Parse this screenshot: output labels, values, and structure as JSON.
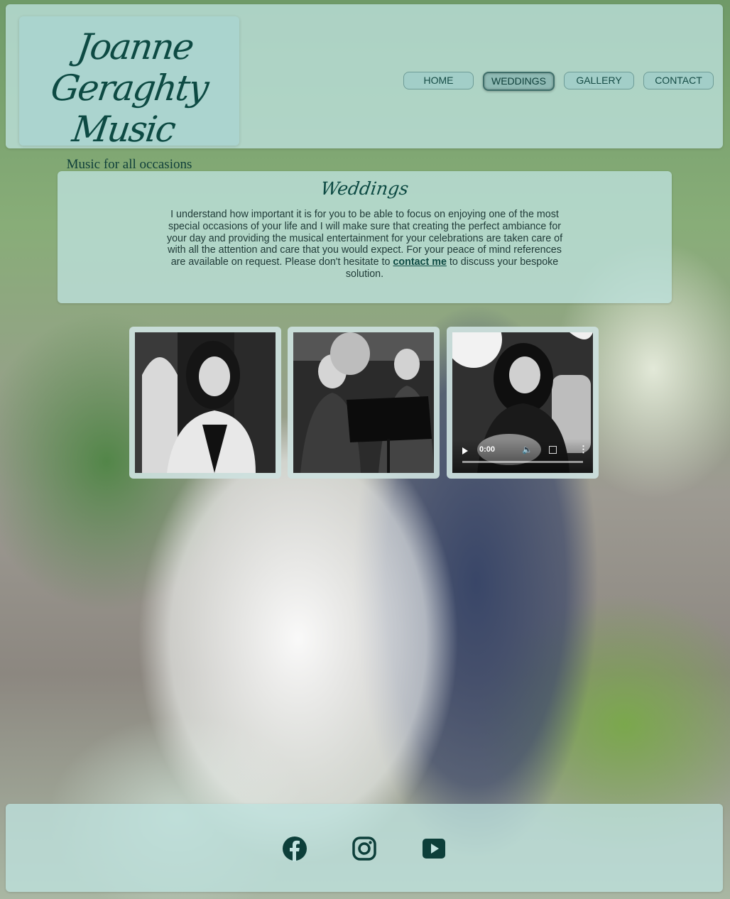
{
  "brand": {
    "name_line1": "Joanne Geraghty",
    "name_line2": "Music",
    "tagline": "Music for all occasions"
  },
  "nav": {
    "items": [
      {
        "label": "HOME"
      },
      {
        "label": "WEDDINGS",
        "active": true
      },
      {
        "label": "GALLERY"
      },
      {
        "label": "CONTACT"
      }
    ]
  },
  "intro": {
    "title": "Weddings",
    "text_before": "I understand how important it is for you to be able to focus on enjoying one of the most special occasions of your life and I will make sure that creating the perfect ambiance for your day and providing the musical entertainment for your celebrations are taken care of with all the attention and care that you would expect. For your peace of mind references are available on request. Please don't hesitate to ",
    "link_text": "contact me",
    "text_after": " to discuss your bespoke solution."
  },
  "gallery": {
    "video": {
      "time": "0:00"
    }
  },
  "footer": {
    "icons": [
      "facebook-icon",
      "instagram-icon",
      "youtube-icon"
    ]
  },
  "colors": {
    "accent": "#0d4a43",
    "panel": "#bee1de"
  }
}
